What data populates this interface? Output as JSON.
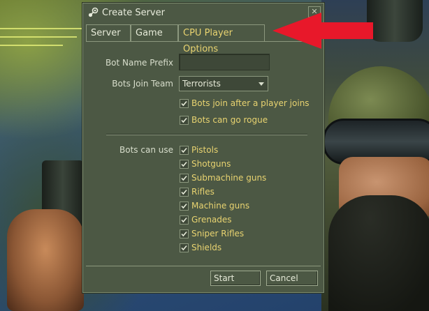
{
  "window": {
    "title": "Create Server",
    "close_label": "✕"
  },
  "tabs": [
    {
      "label": "Server",
      "active": false
    },
    {
      "label": "Game",
      "active": false
    },
    {
      "label": "CPU Player Options",
      "active": true
    }
  ],
  "form": {
    "bot_name_prefix": {
      "label": "Bot Name Prefix",
      "value": ""
    },
    "bots_join_team": {
      "label": "Bots Join Team",
      "value": "Terrorists"
    },
    "options": [
      {
        "label": "Bots join after a player joins",
        "checked": true
      },
      {
        "label": "Bots can go rogue",
        "checked": true
      }
    ],
    "weapons": {
      "label": "Bots can use",
      "items": [
        {
          "label": "Pistols",
          "checked": true
        },
        {
          "label": "Shotguns",
          "checked": true
        },
        {
          "label": "Submachine guns",
          "checked": true
        },
        {
          "label": "Rifles",
          "checked": true
        },
        {
          "label": "Machine guns",
          "checked": true
        },
        {
          "label": "Grenades",
          "checked": true
        },
        {
          "label": "Sniper Rifles",
          "checked": true
        },
        {
          "label": "Shields",
          "checked": true
        }
      ]
    }
  },
  "buttons": {
    "start": "Start",
    "cancel": "Cancel"
  },
  "colors": {
    "dialog_bg": "#4c5844",
    "accent_text": "#e8d370",
    "annotation_arrow": "#e8182a"
  },
  "icons": {
    "title": "steam-logo-icon",
    "check": "checkmark-icon",
    "dropdown": "chevron-down-icon",
    "annotation": "red-arrow-icon"
  }
}
